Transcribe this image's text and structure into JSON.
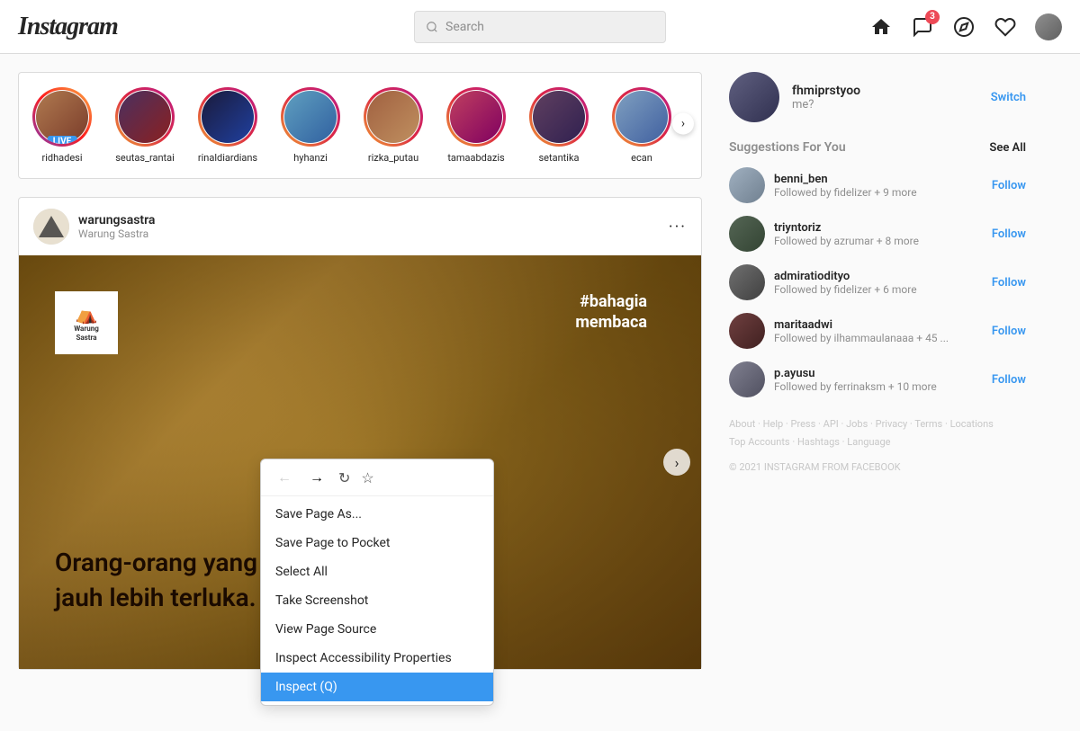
{
  "header": {
    "logo": "Instagram",
    "search_placeholder": "Search",
    "nav": {
      "messenger_badge": "3"
    }
  },
  "stories": {
    "items": [
      {
        "username": "ridhadesi",
        "live": true
      },
      {
        "username": "seutas_rantai",
        "live": false
      },
      {
        "username": "rinaldiardians",
        "live": false
      },
      {
        "username": "hyhanzi",
        "live": false
      },
      {
        "username": "rizka_putau",
        "live": false
      },
      {
        "username": "tamaabdazis",
        "live": false
      },
      {
        "username": "setantika",
        "live": false
      },
      {
        "username": "ecan",
        "live": false
      }
    ],
    "live_label": "LIVE",
    "next_btn": "›"
  },
  "post": {
    "username": "warungsastra",
    "subtext": "Warung Sastra",
    "hashtag": "#bahagia\nmembaca",
    "logo_text": "Warung\nSastra",
    "quote": "Orang-orang yang melukaimu,\njauh lebih terluka.",
    "next_btn": "›"
  },
  "context_menu": {
    "back_btn": "←",
    "forward_btn": "→",
    "refresh_btn": "↻",
    "star_btn": "☆",
    "items": [
      {
        "label": "Save Page As...",
        "highlighted": false
      },
      {
        "label": "Save Page to Pocket",
        "highlighted": false
      },
      {
        "label": "Select All",
        "highlighted": false
      },
      {
        "label": "Take Screenshot",
        "highlighted": false
      },
      {
        "label": "View Page Source",
        "highlighted": false
      },
      {
        "label": "Inspect Accessibility Properties",
        "highlighted": false
      },
      {
        "label": "Inspect (Q)",
        "highlighted": true
      }
    ]
  },
  "sidebar": {
    "profile": {
      "username": "fhmiprstyoo",
      "subtext": "me?",
      "switch_label": "Switch"
    },
    "suggestions_title": "Suggestions For You",
    "see_all_label": "See All",
    "suggestions": [
      {
        "username": "benni_ben",
        "sub": "Followed by fidelizer + 9 more",
        "follow_label": "Follow"
      },
      {
        "username": "triyntoriz",
        "sub": "Followed by azrumar + 8 more",
        "follow_label": "Follow"
      },
      {
        "username": "admiratiodityo",
        "sub": "Followed by fidelizer + 6 more",
        "follow_label": "Follow"
      },
      {
        "username": "maritaadwi",
        "sub": "Followed by ilhammaulanaaa + 45 ...",
        "follow_label": "Follow"
      },
      {
        "username": "p.ayusu",
        "sub": "Followed by ferrinaksm + 10 more",
        "follow_label": "Follow"
      }
    ],
    "footer": {
      "links": [
        "About",
        "Help",
        "Press",
        "API",
        "Jobs",
        "Privacy",
        "Terms",
        "Locations",
        "Top Accounts",
        "Hashtags",
        "Language"
      ],
      "copyright": "© 2021 INSTAGRAM FROM FACEBOOK"
    }
  }
}
